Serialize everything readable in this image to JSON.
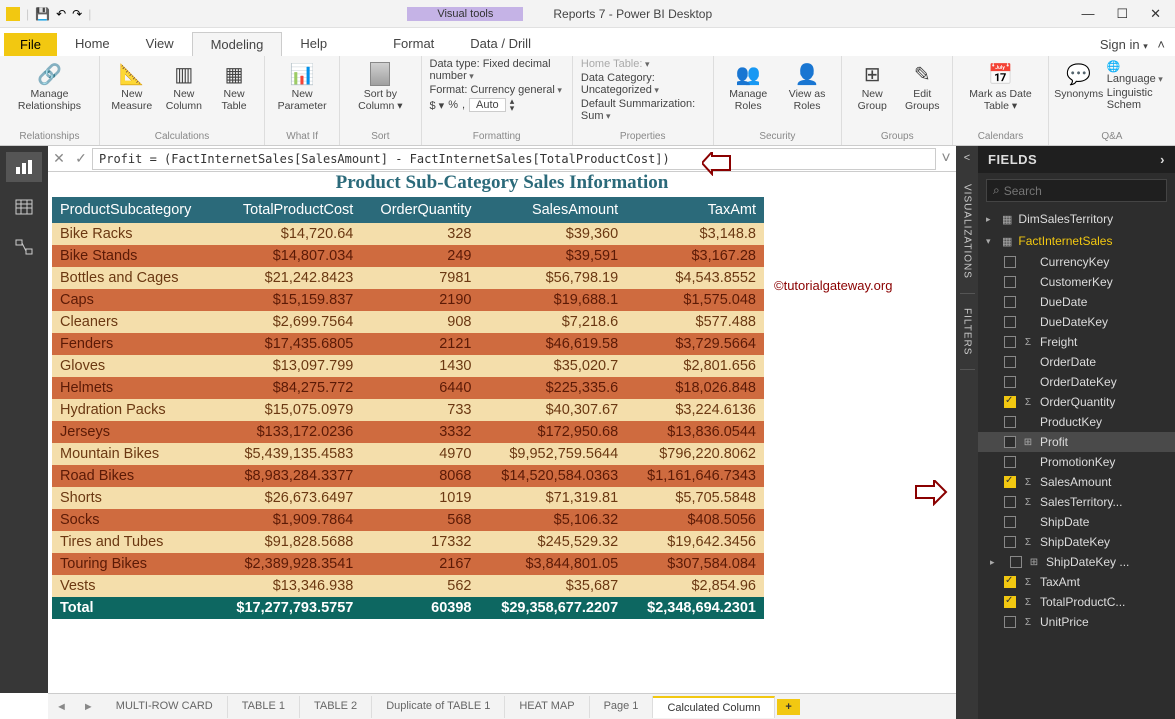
{
  "title": "Reports 7 - Power BI Desktop",
  "visual_tools_label": "Visual tools",
  "signin": "Sign in",
  "file_tab": "File",
  "menu_tabs": [
    "Home",
    "View",
    "Modeling",
    "Help",
    "Format",
    "Data / Drill"
  ],
  "ribbon": {
    "relationships": {
      "label": "Relationships",
      "btn": "Manage\nRelationships"
    },
    "calculations": {
      "label": "Calculations",
      "btns": [
        "New\nMeasure",
        "New\nColumn",
        "New\nTable"
      ]
    },
    "whatif": {
      "label": "What If",
      "btn": "New\nParameter"
    },
    "sort": {
      "label": "Sort",
      "btn": "Sort by\nColumn ▾"
    },
    "formatting": {
      "label": "Formatting",
      "datatype": "Data type: Fixed decimal number",
      "format": "Format: Currency general",
      "auto": "Auto"
    },
    "properties": {
      "label": "Properties",
      "home_table": "Home Table:",
      "category": "Data Category: Uncategorized",
      "summ": "Default Summarization: Sum"
    },
    "security": {
      "label": "Security",
      "btns": [
        "Manage\nRoles",
        "View as\nRoles"
      ]
    },
    "groups": {
      "label": "Groups",
      "btns": [
        "New\nGroup",
        "Edit\nGroups"
      ]
    },
    "calendars": {
      "label": "Calendars",
      "btn": "Mark as\nDate Table ▾"
    },
    "qa": {
      "label": "Q&A",
      "syn": "Synonyms",
      "lang": "Language",
      "ling": "Linguistic Schem"
    }
  },
  "formula": "Profit = (FactInternetSales[SalesAmount] - FactInternetSales[TotalProductCost])",
  "report": {
    "title": "Product Sub-Category Sales Information",
    "headers": [
      "ProductSubcategory",
      "TotalProductCost",
      "OrderQuantity",
      "SalesAmount",
      "TaxAmt"
    ],
    "rows": [
      [
        "Bike Racks",
        "$14,720.64",
        "328",
        "$39,360",
        "$3,148.8"
      ],
      [
        "Bike Stands",
        "$14,807.034",
        "249",
        "$39,591",
        "$3,167.28"
      ],
      [
        "Bottles and Cages",
        "$21,242.8423",
        "7981",
        "$56,798.19",
        "$4,543.8552"
      ],
      [
        "Caps",
        "$15,159.837",
        "2190",
        "$19,688.1",
        "$1,575.048"
      ],
      [
        "Cleaners",
        "$2,699.7564",
        "908",
        "$7,218.6",
        "$577.488"
      ],
      [
        "Fenders",
        "$17,435.6805",
        "2121",
        "$46,619.58",
        "$3,729.5664"
      ],
      [
        "Gloves",
        "$13,097.799",
        "1430",
        "$35,020.7",
        "$2,801.656"
      ],
      [
        "Helmets",
        "$84,275.772",
        "6440",
        "$225,335.6",
        "$18,026.848"
      ],
      [
        "Hydration Packs",
        "$15,075.0979",
        "733",
        "$40,307.67",
        "$3,224.6136"
      ],
      [
        "Jerseys",
        "$133,172.0236",
        "3332",
        "$172,950.68",
        "$13,836.0544"
      ],
      [
        "Mountain Bikes",
        "$5,439,135.4583",
        "4970",
        "$9,952,759.5644",
        "$796,220.8062"
      ],
      [
        "Road Bikes",
        "$8,983,284.3377",
        "8068",
        "$14,520,584.0363",
        "$1,161,646.7343"
      ],
      [
        "Shorts",
        "$26,673.6497",
        "1019",
        "$71,319.81",
        "$5,705.5848"
      ],
      [
        "Socks",
        "$1,909.7864",
        "568",
        "$5,106.32",
        "$408.5056"
      ],
      [
        "Tires and Tubes",
        "$91,828.5688",
        "17332",
        "$245,529.32",
        "$19,642.3456"
      ],
      [
        "Touring Bikes",
        "$2,389,928.3541",
        "2167",
        "$3,844,801.05",
        "$307,584.084"
      ],
      [
        "Vests",
        "$13,346.938",
        "562",
        "$35,687",
        "$2,854.96"
      ]
    ],
    "total": [
      "Total",
      "$17,277,793.5757",
      "60398",
      "$29,358,677.2207",
      "$2,348,694.2301"
    ]
  },
  "sheet_tabs": [
    "MULTI-ROW CARD",
    "TABLE 1",
    "TABLE 2",
    "Duplicate of TABLE 1",
    "HEAT MAP",
    "Page 1",
    "Calculated Column"
  ],
  "vtabs": [
    "VISUALIZATIONS",
    "FILTERS"
  ],
  "fields": {
    "header": "FIELDS",
    "search_placeholder": "Search",
    "tables": [
      {
        "name": "DimSalesTerritory",
        "expanded": false,
        "selected": false
      },
      {
        "name": "FactInternetSales",
        "expanded": true,
        "selected": true,
        "fields": [
          {
            "name": "CurrencyKey",
            "checked": false,
            "icon": ""
          },
          {
            "name": "CustomerKey",
            "checked": false,
            "icon": ""
          },
          {
            "name": "DueDate",
            "checked": false,
            "icon": ""
          },
          {
            "name": "DueDateKey",
            "checked": false,
            "icon": ""
          },
          {
            "name": "Freight",
            "checked": false,
            "icon": "Σ"
          },
          {
            "name": "OrderDate",
            "checked": false,
            "icon": ""
          },
          {
            "name": "OrderDateKey",
            "checked": false,
            "icon": ""
          },
          {
            "name": "OrderQuantity",
            "checked": true,
            "icon": "Σ"
          },
          {
            "name": "ProductKey",
            "checked": false,
            "icon": ""
          },
          {
            "name": "Profit",
            "checked": false,
            "icon": "⊞",
            "selected": true
          },
          {
            "name": "PromotionKey",
            "checked": false,
            "icon": ""
          },
          {
            "name": "SalesAmount",
            "checked": true,
            "icon": "Σ"
          },
          {
            "name": "SalesTerritory...",
            "checked": false,
            "icon": "Σ"
          },
          {
            "name": "ShipDate",
            "checked": false,
            "icon": ""
          },
          {
            "name": "ShipDateKey",
            "checked": false,
            "icon": "Σ"
          },
          {
            "name": "ShipDateKey ...",
            "checked": false,
            "icon": "⊞",
            "caret": true
          },
          {
            "name": "TaxAmt",
            "checked": true,
            "icon": "Σ"
          },
          {
            "name": "TotalProductC...",
            "checked": true,
            "icon": "Σ"
          },
          {
            "name": "UnitPrice",
            "checked": false,
            "icon": "Σ"
          }
        ]
      }
    ]
  },
  "watermark": "©tutorialgateway.org"
}
